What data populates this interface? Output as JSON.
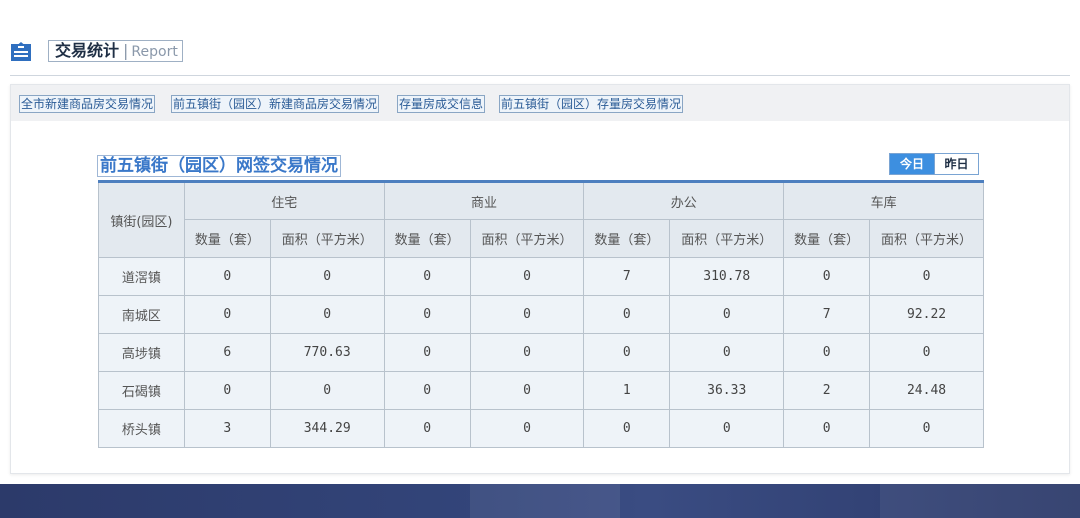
{
  "header": {
    "title": "交易统计",
    "separator": "|",
    "subtitle": "Report",
    "icon": "building-document-icon"
  },
  "tabs": [
    {
      "label": "全市新建商品房交易情况"
    },
    {
      "label": "前五镇街（园区）新建商品房交易情况"
    },
    {
      "label": "存量房成交信息"
    },
    {
      "label": "前五镇街（园区）存量房交易情况"
    }
  ],
  "section": {
    "title": "前五镇街（园区）网签交易情况",
    "toggle": {
      "today": "今日",
      "yesterday": "昨日",
      "selected": "today"
    }
  },
  "table": {
    "row_header": "镇街(园区)",
    "groups": [
      "住宅",
      "商业",
      "办公",
      "车库"
    ],
    "subheaders": [
      "数量（套）",
      "面积（平方米）"
    ],
    "rows": [
      {
        "town": "道滘镇",
        "values": [
          "0",
          "0",
          "0",
          "0",
          "7",
          "310.78",
          "0",
          "0"
        ]
      },
      {
        "town": "南城区",
        "values": [
          "0",
          "0",
          "0",
          "0",
          "0",
          "0",
          "7",
          "92.22"
        ]
      },
      {
        "town": "高埗镇",
        "values": [
          "6",
          "770.63",
          "0",
          "0",
          "0",
          "0",
          "0",
          "0"
        ]
      },
      {
        "town": "石碣镇",
        "values": [
          "0",
          "0",
          "0",
          "0",
          "1",
          "36.33",
          "2",
          "24.48"
        ]
      },
      {
        "town": "桥头镇",
        "values": [
          "3",
          "344.29",
          "0",
          "0",
          "0",
          "0",
          "0",
          "0"
        ]
      }
    ]
  },
  "colors": {
    "accent": "#3d8fe0",
    "title": "#3a78c9",
    "table_top_border": "#4d7fbf",
    "footer": "#2c3a6a"
  }
}
